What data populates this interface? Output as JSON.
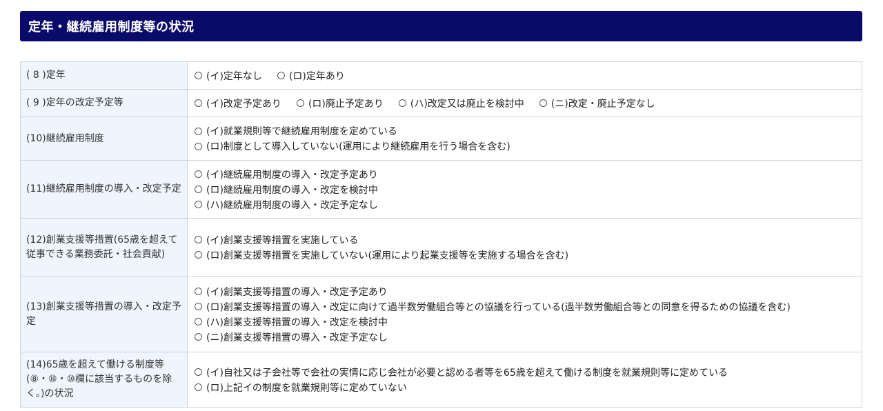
{
  "section": {
    "title": "定年・継続雇用制度等の状況"
  },
  "rows": [
    {
      "label": "( 8 )定年",
      "layout": "inline",
      "options": [
        "(イ)定年なし",
        "(ロ)定年あり"
      ]
    },
    {
      "label": "( 9 )定年の改定予定等",
      "layout": "inline",
      "options": [
        "(イ)改定予定あり",
        "(ロ)廃止予定あり",
        "(ハ)改定又は廃止を検討中",
        "(ニ)改定・廃止予定なし"
      ]
    },
    {
      "label": "(10)継続雇用制度",
      "layout": "stacked",
      "options": [
        "(イ)就業規則等で継続雇用制度を定めている",
        "(ロ)制度として導入していない(運用により継続雇用を行う場合を含む)"
      ]
    },
    {
      "label": "(11)継続雇用制度の導入・改定予定",
      "layout": "stacked",
      "options": [
        "(イ)継続雇用制度の導入・改定予定あり",
        "(ロ)継続雇用制度の導入・改定を検討中",
        "(ハ)継続雇用制度の導入・改定予定なし"
      ]
    },
    {
      "label": "(12)創業支援等措置(65歳を超えて従事できる業務委託・社会貢献)",
      "layout": "stacked",
      "options": [
        "(イ)創業支援等措置を実施している",
        "(ロ)創業支援等措置を実施していない(運用により起業支援等を実施する場合を含む)"
      ]
    },
    {
      "label": "(13)創業支援等措置の導入・改定予定",
      "layout": "stacked",
      "options": [
        "(イ)創業支援等措置の導入・改定予定あり",
        "(ロ)創業支援等措置の導入・改定に向けて過半数労働組合等との協議を行っている(過半数労働組合等との同意を得るための協議を含む)",
        "(ハ)創業支援等措置の導入・改定を検討中",
        "(ニ)創業支援等措置の導入・改定予定なし"
      ]
    },
    {
      "label": "(14)65歳を超えて働ける制度等(⑧・⑩・⑩欄に該当するものを除く。)の状況",
      "layout": "stacked",
      "options": [
        "(イ)自社又は子会社等で会社の実情に応じ会社が必要と認める者等を65歳を超えて働ける制度を就業規則等に定めている",
        "(ロ)上記イの制度を就業規則等に定めていない"
      ]
    }
  ]
}
